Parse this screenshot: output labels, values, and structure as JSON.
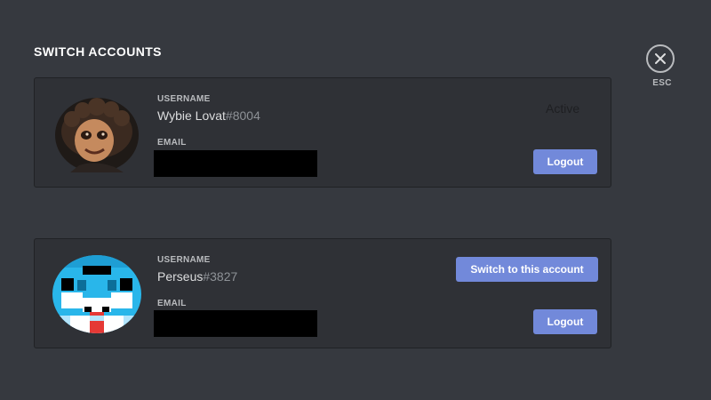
{
  "modal": {
    "title": "SWITCH ACCOUNTS",
    "close_label": "ESC"
  },
  "accounts": [
    {
      "username_label": "USERNAME",
      "username": "Wybie Lovat",
      "discriminator": "#8004",
      "email_label": "EMAIL",
      "email_value": "",
      "status": "Active",
      "logout_label": "Logout"
    },
    {
      "username_label": "USERNAME",
      "username": "Perseus",
      "discriminator": "#3827",
      "email_label": "EMAIL",
      "email_value": "",
      "switch_label": "Switch to this account",
      "logout_label": "Logout"
    }
  ],
  "colors": {
    "background": "#36393f",
    "card": "#2f3136",
    "blurple": "#7289da",
    "redacted": "#000000"
  },
  "icons": {
    "close": "close-icon"
  }
}
